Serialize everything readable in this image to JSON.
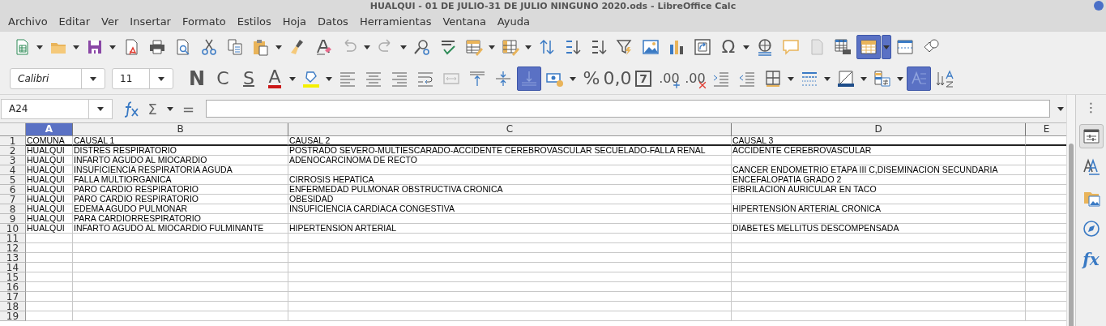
{
  "window": {
    "title": "HUALQUI - 01 DE JULIO-31 DE JULIO NINGUNO 2020.ods - LibreOffice Calc"
  },
  "menu": [
    "Archivo",
    "Editar",
    "Ver",
    "Insertar",
    "Formato",
    "Estilos",
    "Hoja",
    "Datos",
    "Herramientas",
    "Ventana",
    "Ayuda"
  ],
  "toolbar_standard": [
    {
      "kind": "icon",
      "on": false,
      "menu": true
    },
    {
      "kind": "icon",
      "on": false,
      "menu": true
    },
    {
      "kind": "icon",
      "on": false,
      "menu": true
    },
    {
      "kind": "icon",
      "on": false,
      "menu": false
    },
    {
      "kind": "icon",
      "on": false,
      "menu": false
    },
    {
      "kind": "icon",
      "on": false,
      "menu": false
    },
    {
      "kind": "icon",
      "on": false,
      "menu": false
    },
    {
      "kind": "icon",
      "on": false,
      "menu": false
    },
    {
      "kind": "icon",
      "on": false,
      "menu": true
    },
    {
      "kind": "icon",
      "on": false,
      "menu": false
    },
    {
      "kind": "icon",
      "on": false,
      "menu": false
    },
    {
      "kind": "icon",
      "on": false,
      "menu": true
    },
    {
      "kind": "icon",
      "on": false,
      "menu": true
    },
    {
      "kind": "icon",
      "on": false,
      "menu": false
    },
    {
      "kind": "icon",
      "on": false,
      "menu": false
    },
    {
      "kind": "icon",
      "on": false,
      "menu": true
    },
    {
      "kind": "icon",
      "on": false,
      "menu": true
    },
    {
      "kind": "icon",
      "on": false,
      "menu": false
    },
    {
      "kind": "icon",
      "on": false,
      "menu": false
    },
    {
      "kind": "icon",
      "on": false,
      "menu": false
    },
    {
      "kind": "icon",
      "on": false,
      "menu": false
    },
    {
      "kind": "icon",
      "on": false,
      "menu": false
    },
    {
      "kind": "icon",
      "on": false,
      "menu": false
    },
    {
      "kind": "icon",
      "on": false,
      "menu": false
    },
    {
      "kind": "glyph",
      "label": "Ω",
      "on": false,
      "menu": true
    },
    {
      "kind": "icon",
      "on": false,
      "menu": false
    },
    {
      "kind": "icon",
      "on": false,
      "menu": false
    },
    {
      "kind": "icon",
      "on": false,
      "menu": false
    },
    {
      "kind": "icon",
      "on": false,
      "menu": false
    },
    {
      "kind": "icon",
      "on": true,
      "menu": true
    },
    {
      "kind": "icon",
      "on": false,
      "menu": false
    },
    {
      "kind": "icon",
      "on": false,
      "menu": false
    }
  ],
  "font_name": "Calibri",
  "font_size": "11",
  "toolbar_format": [
    {
      "kind": "bold-glyph",
      "label": "N",
      "on": false,
      "menu": false
    },
    {
      "kind": "glyph",
      "label": "C",
      "on": false,
      "menu": false
    },
    {
      "kind": "underline-glyph",
      "label": "S",
      "on": false,
      "menu": false
    },
    {
      "kind": "color-glyph",
      "label": "A",
      "on": false,
      "menu": true
    },
    {
      "kind": "icon",
      "on": false,
      "menu": true
    },
    {
      "kind": "icon",
      "on": false,
      "menu": false
    },
    {
      "kind": "icon",
      "on": false,
      "menu": false
    },
    {
      "kind": "icon",
      "on": false,
      "menu": false
    },
    {
      "kind": "icon",
      "on": false,
      "menu": false
    },
    {
      "kind": "icon",
      "on": false,
      "menu": false
    },
    {
      "kind": "icon",
      "on": false,
      "menu": false
    },
    {
      "kind": "icon",
      "on": false,
      "menu": false
    },
    {
      "kind": "icon",
      "on": true,
      "menu": false
    },
    {
      "kind": "icon",
      "on": false,
      "menu": true
    },
    {
      "kind": "glyph",
      "label": "%",
      "on": false,
      "menu": false
    },
    {
      "kind": "glyph",
      "label": "0,0",
      "on": false,
      "menu": false
    },
    {
      "kind": "boxed-glyph",
      "label": "7",
      "on": false,
      "menu": false
    },
    {
      "kind": "plus-glyph",
      "label": ".00",
      "on": false,
      "menu": false
    },
    {
      "kind": "cross-glyph",
      "label": ".00",
      "on": false,
      "menu": false
    },
    {
      "kind": "icon",
      "on": false,
      "menu": false
    },
    {
      "kind": "icon",
      "on": false,
      "menu": false
    },
    {
      "kind": "icon",
      "on": false,
      "menu": true
    },
    {
      "kind": "icon",
      "on": false,
      "menu": true
    },
    {
      "kind": "icon",
      "on": false,
      "menu": true
    },
    {
      "kind": "icon",
      "on": false,
      "menu": true
    },
    {
      "kind": "icon",
      "on": true,
      "menu": false
    },
    {
      "kind": "icon",
      "on": false,
      "menu": false
    }
  ],
  "formula_bar": {
    "name_box": "A24",
    "sum": "Σ",
    "equals": "="
  },
  "sheet": {
    "columns": [
      {
        "label": "A",
        "selected": true
      },
      {
        "label": "B",
        "selected": false
      },
      {
        "label": "C",
        "selected": false
      },
      {
        "label": "D",
        "selected": false
      },
      {
        "label": "E",
        "selected": false
      }
    ],
    "rows": [
      {
        "number": "1",
        "cells": [
          "COMUNA",
          "CAUSAL 1",
          "CAUSAL 2",
          "CAUSAL 3",
          null
        ]
      },
      {
        "number": "2",
        "cells": [
          "HUALQUI",
          "DISTRES RESPIRATORIO",
          "POSTRADO SEVERO-MULTIESCARADO-ACCIDENTE CEREBROVASCULAR SECUELADO-FALLA RENAL",
          "ACCIDENTE CEREBROVASCULAR",
          null
        ]
      },
      {
        "number": "3",
        "cells": [
          "HUALQUI",
          "INFARTO AGUDO AL MIOCARDIO",
          "ADENOCARCINOMA DE RECTO",
          null,
          null
        ]
      },
      {
        "number": "4",
        "cells": [
          "HUALQUI",
          "INSUFICIENCIA RESPIRATORIA AGUDA",
          null,
          "CANCER ENDOMETRIO ETAPA III C,DISEMINACION SECUNDARIA",
          null
        ]
      },
      {
        "number": "5",
        "cells": [
          "HUALQUI",
          "FALLA MULTIORGANICA",
          "CIRROSIS HEPATÍCA",
          "ENCEFALOPATIA GRADO 2",
          null
        ]
      },
      {
        "number": "6",
        "cells": [
          "HUALQUI",
          "PARO CARDIO RESPIRATORIO",
          "ENFERMEDAD PULMONAR OBSTRUCTIVA CRONICA",
          "FIBRILACION AURICULAR EN TACO",
          null
        ]
      },
      {
        "number": "7",
        "cells": [
          "HUALQUI",
          "PARO CARDIO RESPIRATORIO",
          "OBESIDAD",
          null,
          null
        ]
      },
      {
        "number": "8",
        "cells": [
          "HUALQUI",
          "EDEMA AGUDO PULMONAR",
          "INSUFICIENCIA CARDIACA CONGESTIVA",
          "HIPERTENSIÓN ARTERIAL CRÓNICA",
          null
        ]
      },
      {
        "number": "9",
        "cells": [
          "HUALQUI",
          "PARA CARDIORRESPIRATORIO",
          null,
          null,
          null
        ]
      },
      {
        "number": "10",
        "cells": [
          "HUALQUI",
          "INFARTO AGUDO AL MIOCARDIO FULMINANTE",
          "HIPERTENSIÓN ARTERIAL",
          "DIABETES MELLITUS DESCOMPENSADA",
          null
        ]
      },
      {
        "number": "11"
      },
      {
        "number": "12"
      },
      {
        "number": "13"
      },
      {
        "number": "14"
      },
      {
        "number": "15"
      },
      {
        "number": "16"
      },
      {
        "number": "17"
      },
      {
        "number": "18"
      },
      {
        "number": "19"
      }
    ]
  },
  "sidebar": {
    "menu": "⋮",
    "items": [
      {
        "kind": "icon",
        "selected": true
      },
      {
        "kind": "icon",
        "selected": false
      },
      {
        "kind": "icon",
        "selected": false
      },
      {
        "kind": "icon",
        "selected": false
      },
      {
        "kind": "glyph",
        "label": "fx",
        "selected": false
      }
    ]
  }
}
